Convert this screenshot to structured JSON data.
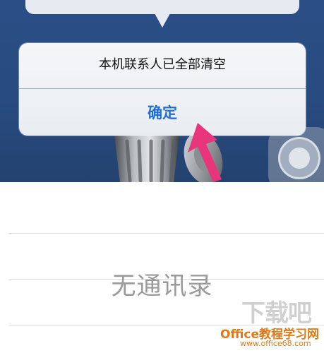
{
  "alert": {
    "message": "本机联系人已全部清空",
    "confirm_label": "确定"
  },
  "contacts": {
    "empty_label": "无通讯录"
  },
  "watermark": {
    "logo_text": "下载吧",
    "brand": "Office教程学习网",
    "url": "www.office68.com"
  },
  "colors": {
    "screen_background": "#284b80",
    "confirm_text": "#1f6fd4",
    "pointer_arrow": "#e8347a",
    "watermark_brand": "#e07a16"
  },
  "icons": [
    "trash-can-icon",
    "pointer-arrow-icon",
    "assistive-touch-icon"
  ]
}
